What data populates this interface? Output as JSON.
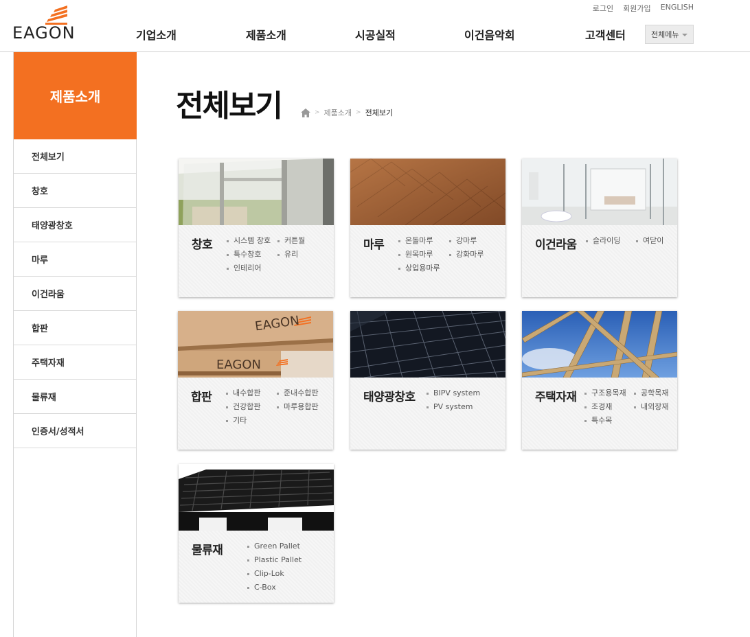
{
  "header": {
    "logo": "EAGON",
    "util": [
      "로그인",
      "회원가입",
      "ENGLISH"
    ],
    "gnb": [
      "기업소개",
      "제품소개",
      "시공실적",
      "이건음악회",
      "고객센터"
    ],
    "all_menu": "전체메뉴"
  },
  "sidebar": {
    "title": "제품소개",
    "items": [
      "전체보기",
      "창호",
      "태양광창호",
      "마루",
      "이건라움",
      "합판",
      "주택자재",
      "물류재",
      "인증서/성적서"
    ]
  },
  "main": {
    "title": "전체보기",
    "breadcrumb": [
      "제품소개",
      "전체보기"
    ],
    "cards": [
      {
        "name": "창호",
        "col1": [
          "시스템 창호",
          "특수창호",
          "인테리어"
        ],
        "col2": [
          "커튼월",
          "유리"
        ]
      },
      {
        "name": "마루",
        "col1": [
          "온돌마루",
          "원목마루",
          "상업용마루"
        ],
        "col2": [
          "강마루",
          "강화마루"
        ]
      },
      {
        "name": "이건라움",
        "col1": [
          "슬라이딩"
        ],
        "col2": [
          "여닫이"
        ]
      },
      {
        "name": "합판",
        "col1": [
          "내수합판",
          "건강합판",
          "기타"
        ],
        "col2": [
          "준내수합판",
          "마루용합판"
        ],
        "thumb_text": [
          "EAGON",
          "EAGON"
        ]
      },
      {
        "name": "태양광창호",
        "col1": [
          "BIPV system",
          "PV system"
        ],
        "col2": []
      },
      {
        "name": "주택자재",
        "col1": [
          "구조용목재",
          "조경재",
          "특수목"
        ],
        "col2": [
          "공학목재",
          "내외장재"
        ]
      },
      {
        "name": "물류재",
        "col1": [
          "Green Pallet",
          "Plastic Pallet",
          "Clip-Lok",
          "C-Box"
        ],
        "col2": []
      }
    ]
  },
  "colors": {
    "accent": "#f37021"
  }
}
